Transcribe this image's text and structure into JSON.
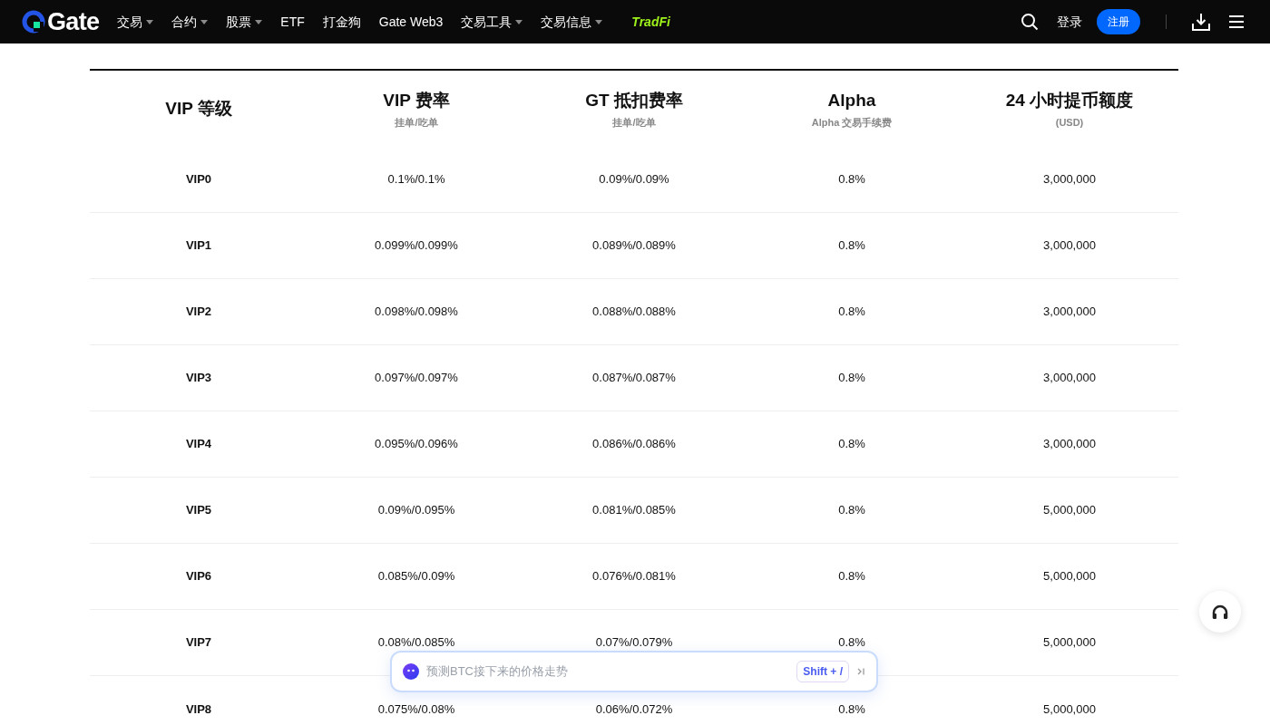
{
  "nav": {
    "items": [
      {
        "label": "交易",
        "dropdown": true
      },
      {
        "label": "合约",
        "dropdown": true
      },
      {
        "label": "股票",
        "dropdown": true
      },
      {
        "label": "ETF",
        "dropdown": false
      },
      {
        "label": "打金狗",
        "dropdown": false
      },
      {
        "label": "Gate Web3",
        "dropdown": false
      },
      {
        "label": "交易工具",
        "dropdown": true
      },
      {
        "label": "交易信息",
        "dropdown": true
      }
    ],
    "logo": "Gate",
    "tradfi": "TradFi",
    "login": "登录",
    "register": "注册"
  },
  "table": {
    "columns": [
      {
        "title": "VIP 等级"
      },
      {
        "title": "VIP 费率",
        "subtitle": "挂单/吃单"
      },
      {
        "title": "GT 抵扣费率",
        "subtitle": "挂单/吃单"
      },
      {
        "title": "Alpha",
        "subtitle": "Alpha 交易手续费"
      },
      {
        "title": "24 小时提币额度",
        "subtitle": "(USD)"
      }
    ],
    "rows": [
      [
        "VIP0",
        "0.1%/0.1%",
        "0.09%/0.09%",
        "0.8%",
        "3,000,000"
      ],
      [
        "VIP1",
        "0.099%/0.099%",
        "0.089%/0.089%",
        "0.8%",
        "3,000,000"
      ],
      [
        "VIP2",
        "0.098%/0.098%",
        "0.088%/0.088%",
        "0.8%",
        "3,000,000"
      ],
      [
        "VIP3",
        "0.097%/0.097%",
        "0.087%/0.087%",
        "0.8%",
        "3,000,000"
      ],
      [
        "VIP4",
        "0.095%/0.096%",
        "0.086%/0.086%",
        "0.8%",
        "3,000,000"
      ],
      [
        "VIP5",
        "0.09%/0.095%",
        "0.081%/0.085%",
        "0.8%",
        "5,000,000"
      ],
      [
        "VIP6",
        "0.085%/0.09%",
        "0.076%/0.081%",
        "0.8%",
        "5,000,000"
      ],
      [
        "VIP7",
        "0.08%/0.085%",
        "0.07%/0.079%",
        "0.8%",
        "5,000,000"
      ],
      [
        "VIP8",
        "0.075%/0.08%",
        "0.06%/0.072%",
        "0.8%",
        "5,000,000"
      ]
    ]
  },
  "assistant": {
    "placeholder": "预测BTC接下来的价格走势",
    "shortcut": "Shift + /"
  }
}
